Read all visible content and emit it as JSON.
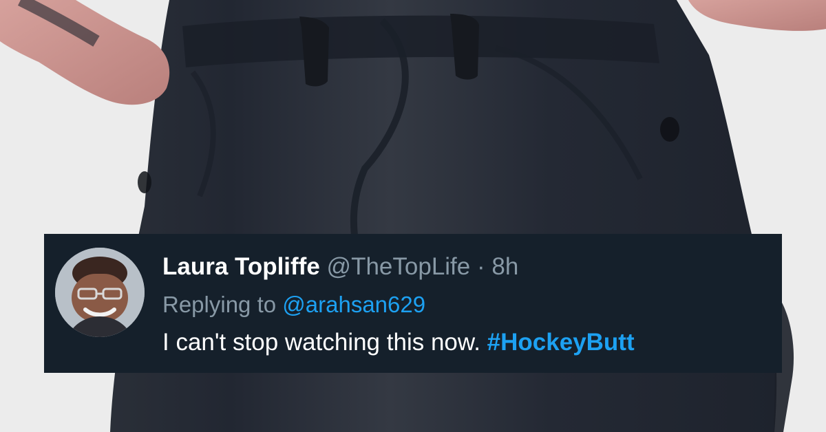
{
  "tweet": {
    "display_name": "Laura Topliffe",
    "handle": "@TheTopLife",
    "separator": " · ",
    "time": "8h",
    "reply_prefix": "Replying to ",
    "reply_handle": "@arahsan629",
    "body_text": "I can't stop watching this now. ",
    "hashtag": "#HockeyButt"
  },
  "theme": {
    "card_background": "#15202b",
    "name_color": "#ffffff",
    "muted_color": "#8899a6",
    "link_color": "#1da1f2",
    "pants_color": "#232933"
  },
  "icons": {
    "avatar": "profile-photo"
  }
}
